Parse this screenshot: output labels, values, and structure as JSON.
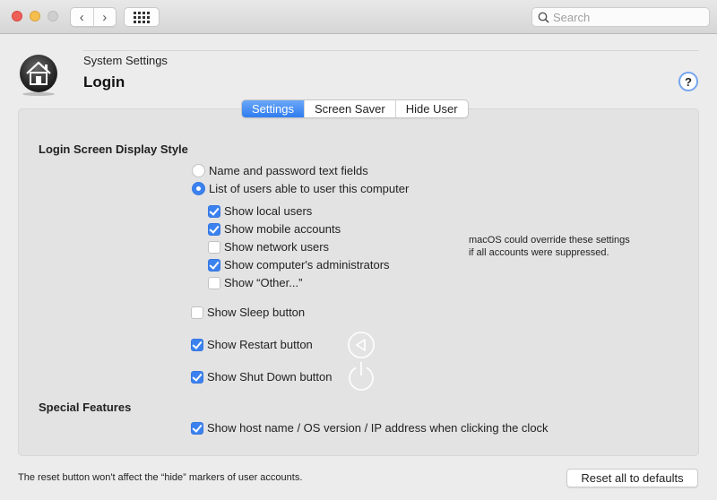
{
  "titlebar": {
    "search_placeholder": "Search",
    "back_glyph": "‹",
    "forward_glyph": "›"
  },
  "header": {
    "breadcrumb": "System Settings",
    "title": "Login",
    "help_glyph": "?"
  },
  "tabs": [
    {
      "label": "Settings",
      "active": true
    },
    {
      "label": "Screen Saver",
      "active": false
    },
    {
      "label": "Hide User",
      "active": false
    }
  ],
  "display_style": {
    "title": "Login Screen Display Style",
    "radios": [
      {
        "label": "Name and password text fields",
        "selected": false
      },
      {
        "label": "List of users able to user this computer",
        "selected": true
      }
    ],
    "user_options": [
      {
        "label": "Show local users",
        "checked": true
      },
      {
        "label": "Show mobile accounts",
        "checked": true
      },
      {
        "label": "Show network users",
        "checked": false
      },
      {
        "label": "Show computer's administrators",
        "checked": true
      },
      {
        "label": "Show “Other...”",
        "checked": false
      }
    ],
    "note_line1": "macOS could override these settings",
    "note_line2": "if all accounts were suppressed.",
    "buttons": [
      {
        "label": "Show Sleep button",
        "checked": false
      },
      {
        "label": "Show Restart button",
        "checked": true
      },
      {
        "label": "Show Shut Down button",
        "checked": true
      }
    ]
  },
  "special": {
    "title": "Special Features",
    "options": [
      {
        "label": "Show host name / OS version / IP address when clicking the clock",
        "checked": true
      }
    ]
  },
  "footer": {
    "note": "The reset button won't affect the “hide” markers of user accounts.",
    "reset_label": "Reset all to defaults"
  },
  "colors": {
    "accent": "#3b82f0",
    "help_ring": "#76a6ef"
  }
}
